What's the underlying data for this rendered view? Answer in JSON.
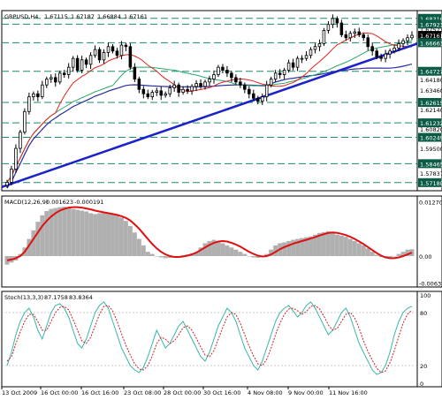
{
  "chart_data": [
    {
      "panel": "price",
      "type": "candlestick",
      "title": "GBPUSD,H4",
      "ohlc_header": [
        "1.67115",
        "1.67187",
        "1.66884",
        "1.67161"
      ],
      "ylim": [
        1.5663,
        1.6884
      ],
      "price_labels": [
        "1.68316",
        "1.67923",
        "1.67573",
        "1.67161",
        "1.66663",
        "1.64180",
        "1.64727",
        "1.63460",
        "1.62140",
        "1.62615",
        "1.61232",
        "1.60820",
        "1.60249",
        "1.59500",
        "1.58465",
        "1.57837",
        "1.57180"
      ],
      "horizontal_levels": [
        1.68316,
        1.67923,
        1.66663,
        1.64727,
        1.62615,
        1.61232,
        1.60249,
        1.58465,
        1.5718
      ],
      "current_price": 1.67161,
      "trendline": {
        "start": 1.5688,
        "end": 1.666
      },
      "close": [
        1.572,
        1.581,
        1.595,
        1.606,
        1.62,
        1.63,
        1.632,
        1.63,
        1.638,
        1.642,
        1.643,
        1.64,
        1.646,
        1.645,
        1.65,
        1.656,
        1.648,
        1.655,
        1.652,
        1.658,
        1.662,
        1.655,
        1.66,
        1.664,
        1.661,
        1.658,
        1.665,
        1.664,
        1.65,
        1.642,
        1.635,
        1.632,
        1.63,
        1.633,
        1.634,
        1.631,
        1.632,
        1.636,
        1.638,
        1.633,
        1.635,
        1.634,
        1.637,
        1.639,
        1.637,
        1.64,
        1.642,
        1.645,
        1.65,
        1.648,
        1.646,
        1.643,
        1.64,
        1.638,
        1.635,
        1.632,
        1.629,
        1.627,
        1.63,
        1.638,
        1.642,
        1.646,
        1.645,
        1.648,
        1.653,
        1.65,
        1.656,
        1.656,
        1.658,
        1.662,
        1.664,
        1.666,
        1.675,
        1.679,
        1.683,
        1.68,
        1.672,
        1.67,
        1.673,
        1.674,
        1.672,
        1.67,
        1.664,
        1.661,
        1.657,
        1.656,
        1.659,
        1.661,
        1.663,
        1.666,
        1.668,
        1.67,
        1.6716
      ]
    },
    {
      "panel": "macd",
      "type": "histogram+line",
      "title": "MACD(12,26,9)",
      "values_header": [
        "0.001623",
        "-0.000191"
      ],
      "ylim": [
        -0.0072,
        0.014
      ],
      "y_ticks": [
        "0.012703",
        "0.00",
        "-0.00630"
      ],
      "histogram": [
        -0.002,
        -0.0015,
        -0.001,
        0.0005,
        0.002,
        0.004,
        0.006,
        0.008,
        0.0095,
        0.0105,
        0.011,
        0.0112,
        0.0114,
        0.0115,
        0.0112,
        0.011,
        0.0108,
        0.0106,
        0.0104,
        0.01,
        0.0098,
        0.01,
        0.0102,
        0.01,
        0.0098,
        0.0095,
        0.009,
        0.0082,
        0.007,
        0.0055,
        0.004,
        0.0025,
        0.001,
        0.0005,
        0.0,
        -0.0003,
        -0.0005,
        -0.0004,
        -0.0003,
        0.0,
        0.0002,
        0.0004,
        0.0006,
        0.0008,
        0.002,
        0.003,
        0.0035,
        0.0038,
        0.0035,
        0.003,
        0.0025,
        0.002,
        0.0015,
        0.001,
        0.0005,
        0.0,
        -0.0003,
        -0.0004,
        -0.0002,
        0.0005,
        0.0015,
        0.0025,
        0.003,
        0.0032,
        0.0035,
        0.0038,
        0.004,
        0.0042,
        0.0044,
        0.0046,
        0.005,
        0.0054,
        0.0056,
        0.0058,
        0.0055,
        0.005,
        0.0048,
        0.0045,
        0.004,
        0.0035,
        0.003,
        0.0025,
        0.0018,
        0.001,
        0.0003,
        -0.0002,
        -0.0004,
        -0.0003,
        0.0,
        0.0005,
        0.001,
        0.0015,
        0.0016
      ],
      "signal": [
        -0.001,
        -0.0008,
        -0.0005,
        0.0,
        0.001,
        0.0025,
        0.004,
        0.0055,
        0.007,
        0.0082,
        0.0092,
        0.01,
        0.0106,
        0.011,
        0.0113,
        0.0114,
        0.0114,
        0.0113,
        0.0111,
        0.0109,
        0.0106,
        0.0104,
        0.0102,
        0.01,
        0.0098,
        0.0096,
        0.0093,
        0.0089,
        0.0083,
        0.0074,
        0.0064,
        0.0052,
        0.004,
        0.0028,
        0.0018,
        0.001,
        0.0004,
        0.0,
        -0.0002,
        -0.0002,
        -0.0001,
        0.0001,
        0.0004,
        0.0008,
        0.0014,
        0.002,
        0.0026,
        0.0031,
        0.0034,
        0.0035,
        0.0034,
        0.0031,
        0.0027,
        0.0022,
        0.0016,
        0.001,
        0.0005,
        0.0001,
        -0.0001,
        0.0,
        0.0004,
        0.001,
        0.0016,
        0.0021,
        0.0025,
        0.0029,
        0.0032,
        0.0035,
        0.0038,
        0.0041,
        0.0044,
        0.0048,
        0.0051,
        0.0054,
        0.0055,
        0.0054,
        0.0052,
        0.0049,
        0.0045,
        0.004,
        0.0034,
        0.0028,
        0.0021,
        0.0014,
        0.0007,
        0.0001,
        -0.0003,
        -0.0005,
        -0.0005,
        -0.0003,
        0.0,
        0.0004,
        0.0008
      ]
    },
    {
      "panel": "stochastic",
      "type": "line",
      "title": "Stoch(13,3,3)",
      "values_header": [
        "87.1758",
        "83.8364"
      ],
      "ylim": [
        0,
        100
      ],
      "y_ticks": [
        "100",
        "80",
        "20",
        "0"
      ],
      "main": [
        20,
        35,
        55,
        70,
        80,
        85,
        75,
        60,
        50,
        65,
        80,
        88,
        90,
        85,
        75,
        60,
        45,
        40,
        50,
        65,
        80,
        88,
        92,
        85,
        70,
        55,
        40,
        30,
        20,
        15,
        12,
        18,
        30,
        45,
        60,
        50,
        40,
        45,
        55,
        65,
        70,
        60,
        50,
        40,
        30,
        25,
        35,
        50,
        65,
        75,
        85,
        80,
        70,
        55,
        40,
        30,
        20,
        15,
        25,
        40,
        55,
        70,
        80,
        85,
        88,
        82,
        75,
        80,
        88,
        92,
        85,
        75,
        65,
        55,
        60,
        70,
        80,
        85,
        75,
        60,
        45,
        35,
        25,
        15,
        10,
        12,
        20,
        35,
        55,
        70,
        80,
        85,
        87
      ],
      "signal": [
        25,
        30,
        45,
        58,
        70,
        78,
        78,
        70,
        60,
        60,
        70,
        80,
        86,
        87,
        83,
        72,
        60,
        48,
        45,
        52,
        65,
        78,
        87,
        88,
        82,
        70,
        56,
        43,
        32,
        22,
        16,
        15,
        20,
        31,
        45,
        52,
        50,
        45,
        48,
        55,
        63,
        65,
        60,
        51,
        41,
        32,
        30,
        37,
        50,
        63,
        75,
        80,
        78,
        68,
        55,
        42,
        31,
        22,
        20,
        27,
        40,
        55,
        68,
        78,
        84,
        85,
        82,
        78,
        81,
        87,
        88,
        84,
        76,
        66,
        60,
        62,
        70,
        78,
        80,
        74,
        62,
        48,
        36,
        26,
        17,
        12,
        14,
        23,
        37,
        53,
        68,
        78,
        83
      ]
    }
  ],
  "x_labels": [
    "13 Oct 2009",
    "16 Oct 00:00",
    "16 Oct 16:00",
    "23 Oct 08:00",
    "28 Oct 00:00",
    "30 Oct 16:00",
    "4 Nov 08:00",
    "9 Nov 00:00",
    "11 Nov 16:00"
  ],
  "colors": {
    "bull": "#000000",
    "bear": "#000000",
    "trendline": "#1a22c8",
    "ma_fast": "#e0241c",
    "ma_mid": "#2aa86a",
    "ma_slow": "#2a2aa0",
    "macd_hist": "#b0b0b0",
    "macd_signal": "#e01010",
    "stoch_main": "#38b8a8",
    "stoch_signal": "#d02020",
    "grid_dash": "#1e8a6e",
    "level_box": "#0a5c46"
  }
}
